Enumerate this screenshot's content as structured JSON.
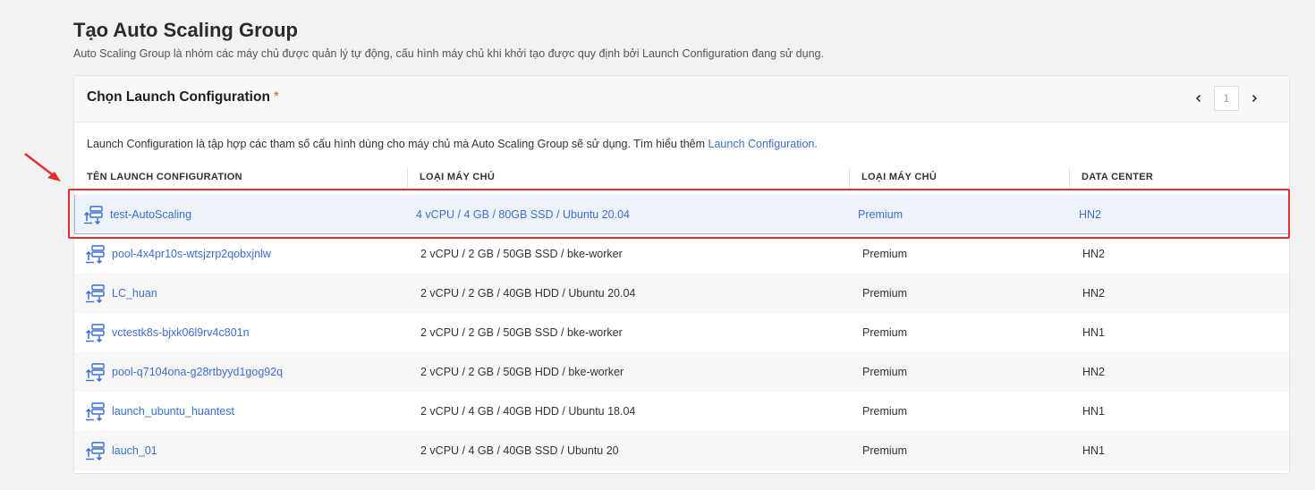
{
  "header": {
    "title": "Tạo Auto Scaling Group",
    "description": "Auto Scaling Group là nhóm các máy chủ được quản lý tự động, cấu hình máy chủ khi khởi tạo được quy định bởi Launch Configuration đang sử dụng."
  },
  "card": {
    "title": "Chọn Launch Configuration",
    "required_mark": "*",
    "pagination": {
      "current_page": "1"
    },
    "intro_text": "Launch Configuration là tập hợp các tham số cấu hình dùng cho máy chủ mà Auto Scaling Group sẽ sử dụng. Tìm hiểu thêm ",
    "intro_link": "Launch Configuration."
  },
  "table": {
    "columns": [
      "TÊN LAUNCH CONFIGURATION",
      "LOẠI MÁY CHỦ",
      "LOẠI MÁY CHỦ",
      "DATA CENTER"
    ],
    "rows": [
      {
        "name": "test-AutoScaling",
        "spec": "4 vCPU / 4 GB / 80GB SSD / Ubuntu 20.04",
        "type": "Premium",
        "dc": "HN2"
      },
      {
        "name": "pool-4x4pr10s-wtsjzrp2qobxjnlw",
        "spec": "2 vCPU / 2 GB / 50GB SSD / bke-worker",
        "type": "Premium",
        "dc": "HN2"
      },
      {
        "name": "LC_huan",
        "spec": "2 vCPU / 2 GB / 40GB HDD / Ubuntu 20.04",
        "type": "Premium",
        "dc": "HN2"
      },
      {
        "name": "vctestk8s-bjxk06l9rv4c801n",
        "spec": "2 vCPU / 2 GB / 50GB SSD / bke-worker",
        "type": "Premium",
        "dc": "HN1"
      },
      {
        "name": "pool-q7104ona-g28rtbyyd1gog92q",
        "spec": "2 vCPU / 2 GB / 50GB HDD / bke-worker",
        "type": "Premium",
        "dc": "HN2"
      },
      {
        "name": "launch_ubuntu_huantest",
        "spec": "2 vCPU / 4 GB / 40GB HDD / Ubuntu 18.04",
        "type": "Premium",
        "dc": "HN1"
      },
      {
        "name": "lauch_01",
        "spec": "2 vCPU / 4 GB / 40GB SSD / Ubuntu 20",
        "type": "Premium",
        "dc": "HN1"
      }
    ]
  },
  "icons": {
    "prev": "chevron-left-icon",
    "next": "chevron-right-icon",
    "row": "launch-config-icon"
  },
  "colors": {
    "link": "#3a6fd8",
    "highlight": "#e52b2b",
    "required": "#e5533d"
  }
}
